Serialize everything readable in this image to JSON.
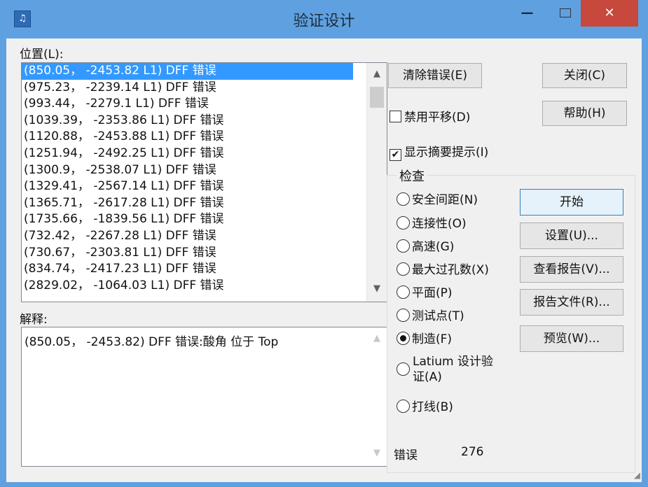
{
  "window": {
    "title": "验证设计",
    "icon_text": "♫"
  },
  "title_buttons": {
    "minimize": "—",
    "close": "✕"
  },
  "location": {
    "label": "位置(L):",
    "items": [
      "(850.05， -2453.82 L1) DFF 错误",
      "(975.23， -2239.14 L1) DFF 错误",
      "(993.44， -2279.1 L1) DFF 错误",
      "(1039.39， -2353.86 L1) DFF 错误",
      "(1120.88， -2453.88 L1) DFF 错误",
      "(1251.94， -2492.25 L1) DFF 错误",
      "(1300.9， -2538.07 L1) DFF 错误",
      "(1329.41， -2567.14 L1) DFF 错误",
      "(1365.71， -2617.28 L1) DFF 错误",
      "(1735.66， -1839.56 L1) DFF 错误",
      "(732.42， -2267.28 L1) DFF 错误",
      "(730.67， -2303.81 L1) DFF 错误",
      "(834.74， -2417.23 L1) DFF 错误",
      "(2829.02， -1064.03 L1) DFF 错误"
    ],
    "selected_index": 0
  },
  "explain": {
    "label": "解释:",
    "text": "(850.05， -2453.82) DFF 错误:酸角 位于 Top"
  },
  "buttons": {
    "clear_errors": "清除错误(E)",
    "close": "关闭(C)",
    "help": "帮助(H)",
    "start": "开始",
    "settings": "设置(U)...",
    "view_report": "查看报告(V)...",
    "report_file": "报告文件(R)...",
    "preview": "预览(W)..."
  },
  "options": {
    "disable_pan": {
      "label": "禁用平移(D)",
      "checked": false,
      "mark": ""
    },
    "show_summary": {
      "label": "显示摘要提示(I)",
      "checked": true,
      "mark": "✔"
    }
  },
  "check_group": {
    "title": "检查",
    "radios": [
      {
        "line1": "安全间距(N)",
        "line2": "",
        "checked": false
      },
      {
        "line1": "连接性(O)",
        "line2": "",
        "checked": false
      },
      {
        "line1": "高速(G)",
        "line2": "",
        "checked": false
      },
      {
        "line1": "最大过孔数(X)",
        "line2": "",
        "checked": false
      },
      {
        "line1": "平面(P)",
        "line2": "",
        "checked": false
      },
      {
        "line1": "测试点(T)",
        "line2": "",
        "checked": false
      },
      {
        "line1": "制造(F)",
        "line2": "",
        "checked": true
      },
      {
        "line1": "Latium 设计验",
        "line2": "证(A)",
        "checked": false
      },
      {
        "line1": "打线(B)",
        "line2": "",
        "checked": false
      }
    ]
  },
  "errors": {
    "label": "错误",
    "count": "276"
  },
  "scroll": {
    "up": "▲",
    "down": "▼"
  }
}
